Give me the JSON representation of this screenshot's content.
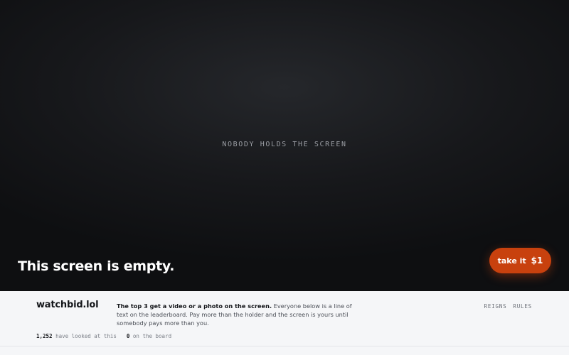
{
  "stage": {
    "status_message": "NOBODY HOLDS THE SCREEN",
    "headline": "This screen is empty."
  },
  "cta": {
    "label": "take it",
    "price": "$1"
  },
  "info": {
    "brand": "watchbid.lol",
    "description_strong": "The top 3 get a video or a photo on the screen.",
    "description_rest": " Everyone below is a line of text on the leaderboard. Pay more than the holder and the screen is yours until somebody pays more than you.",
    "stats": {
      "viewers_count": "1,252",
      "viewers_label": "have looked at this",
      "board_count": "0",
      "board_label": "on the board"
    },
    "nav": {
      "reigns": "REIGNS",
      "rules": "RULES"
    }
  },
  "colors": {
    "accent": "#c8410e",
    "stage_bg": "#17181b",
    "panel_bg": "#f5f6f8"
  }
}
